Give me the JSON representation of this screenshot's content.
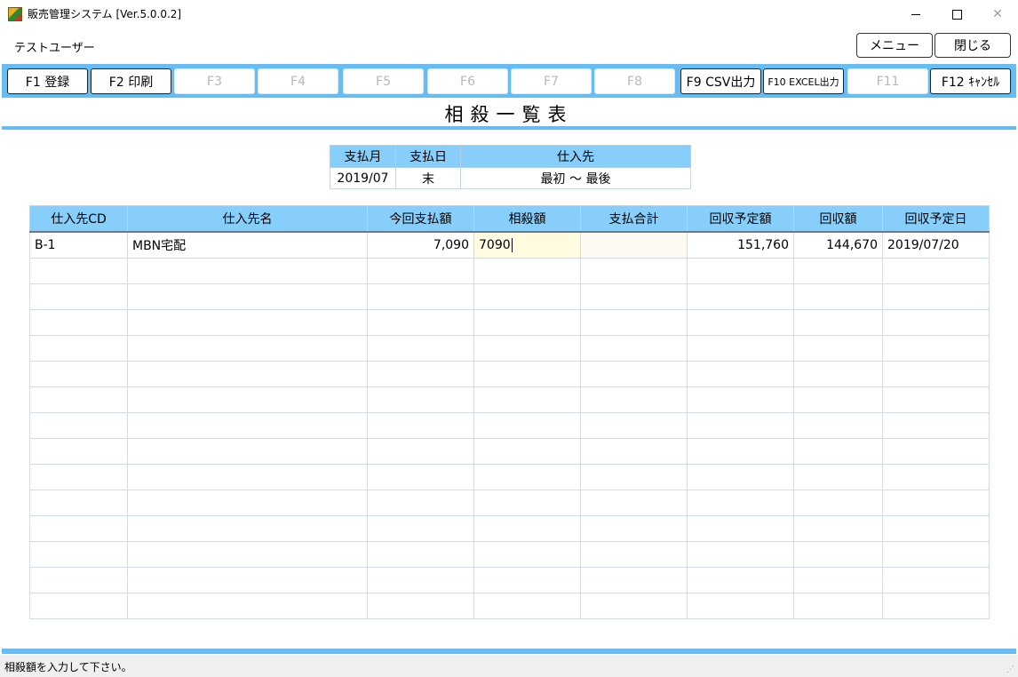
{
  "window": {
    "title": "販売管理システム [Ver.5.0.0.2]",
    "minimize_glyph": "",
    "close_glyph": "✕"
  },
  "user": {
    "name": "テストユーザー"
  },
  "top_buttons": {
    "menu": "メニュー",
    "close": "閉じる"
  },
  "fkeys": [
    {
      "label": "F1 登録",
      "enabled": true
    },
    {
      "label": "F2 印刷",
      "enabled": true
    },
    {
      "label": "F3",
      "enabled": false
    },
    {
      "label": "F4",
      "enabled": false
    },
    {
      "label": "F5",
      "enabled": false
    },
    {
      "label": "F6",
      "enabled": false
    },
    {
      "label": "F7",
      "enabled": false
    },
    {
      "label": "F8",
      "enabled": false
    },
    {
      "label": "F9 CSV出力",
      "enabled": true
    },
    {
      "label": "F10 EXCEL出力",
      "enabled": true
    },
    {
      "label": "F11",
      "enabled": false
    },
    {
      "label": "F12 ｷｬﾝｾﾙ",
      "enabled": true
    }
  ],
  "page_title": "相殺一覧表",
  "filter": {
    "headers": [
      "支払月",
      "支払日",
      "仕入先"
    ],
    "values": [
      "2019/07",
      "末",
      "最初 ～ 最後"
    ]
  },
  "table": {
    "columns": [
      "仕入先CD",
      "仕入先名",
      "今回支払額",
      "相殺額",
      "支払合計",
      "回収予定額",
      "回収額",
      "回収予定日"
    ],
    "rows": [
      [
        "B-1",
        "MBN宅配",
        "7,090",
        "7090",
        "",
        "151,760",
        "144,670",
        "2019/07/20"
      ]
    ],
    "empty_rows": 14
  },
  "status": {
    "message": "相殺額を入力して下さい。"
  },
  "colors": {
    "accent": "#66bdf3",
    "header_bg": "#87cefa",
    "edit_bg": "#fffbe0"
  }
}
